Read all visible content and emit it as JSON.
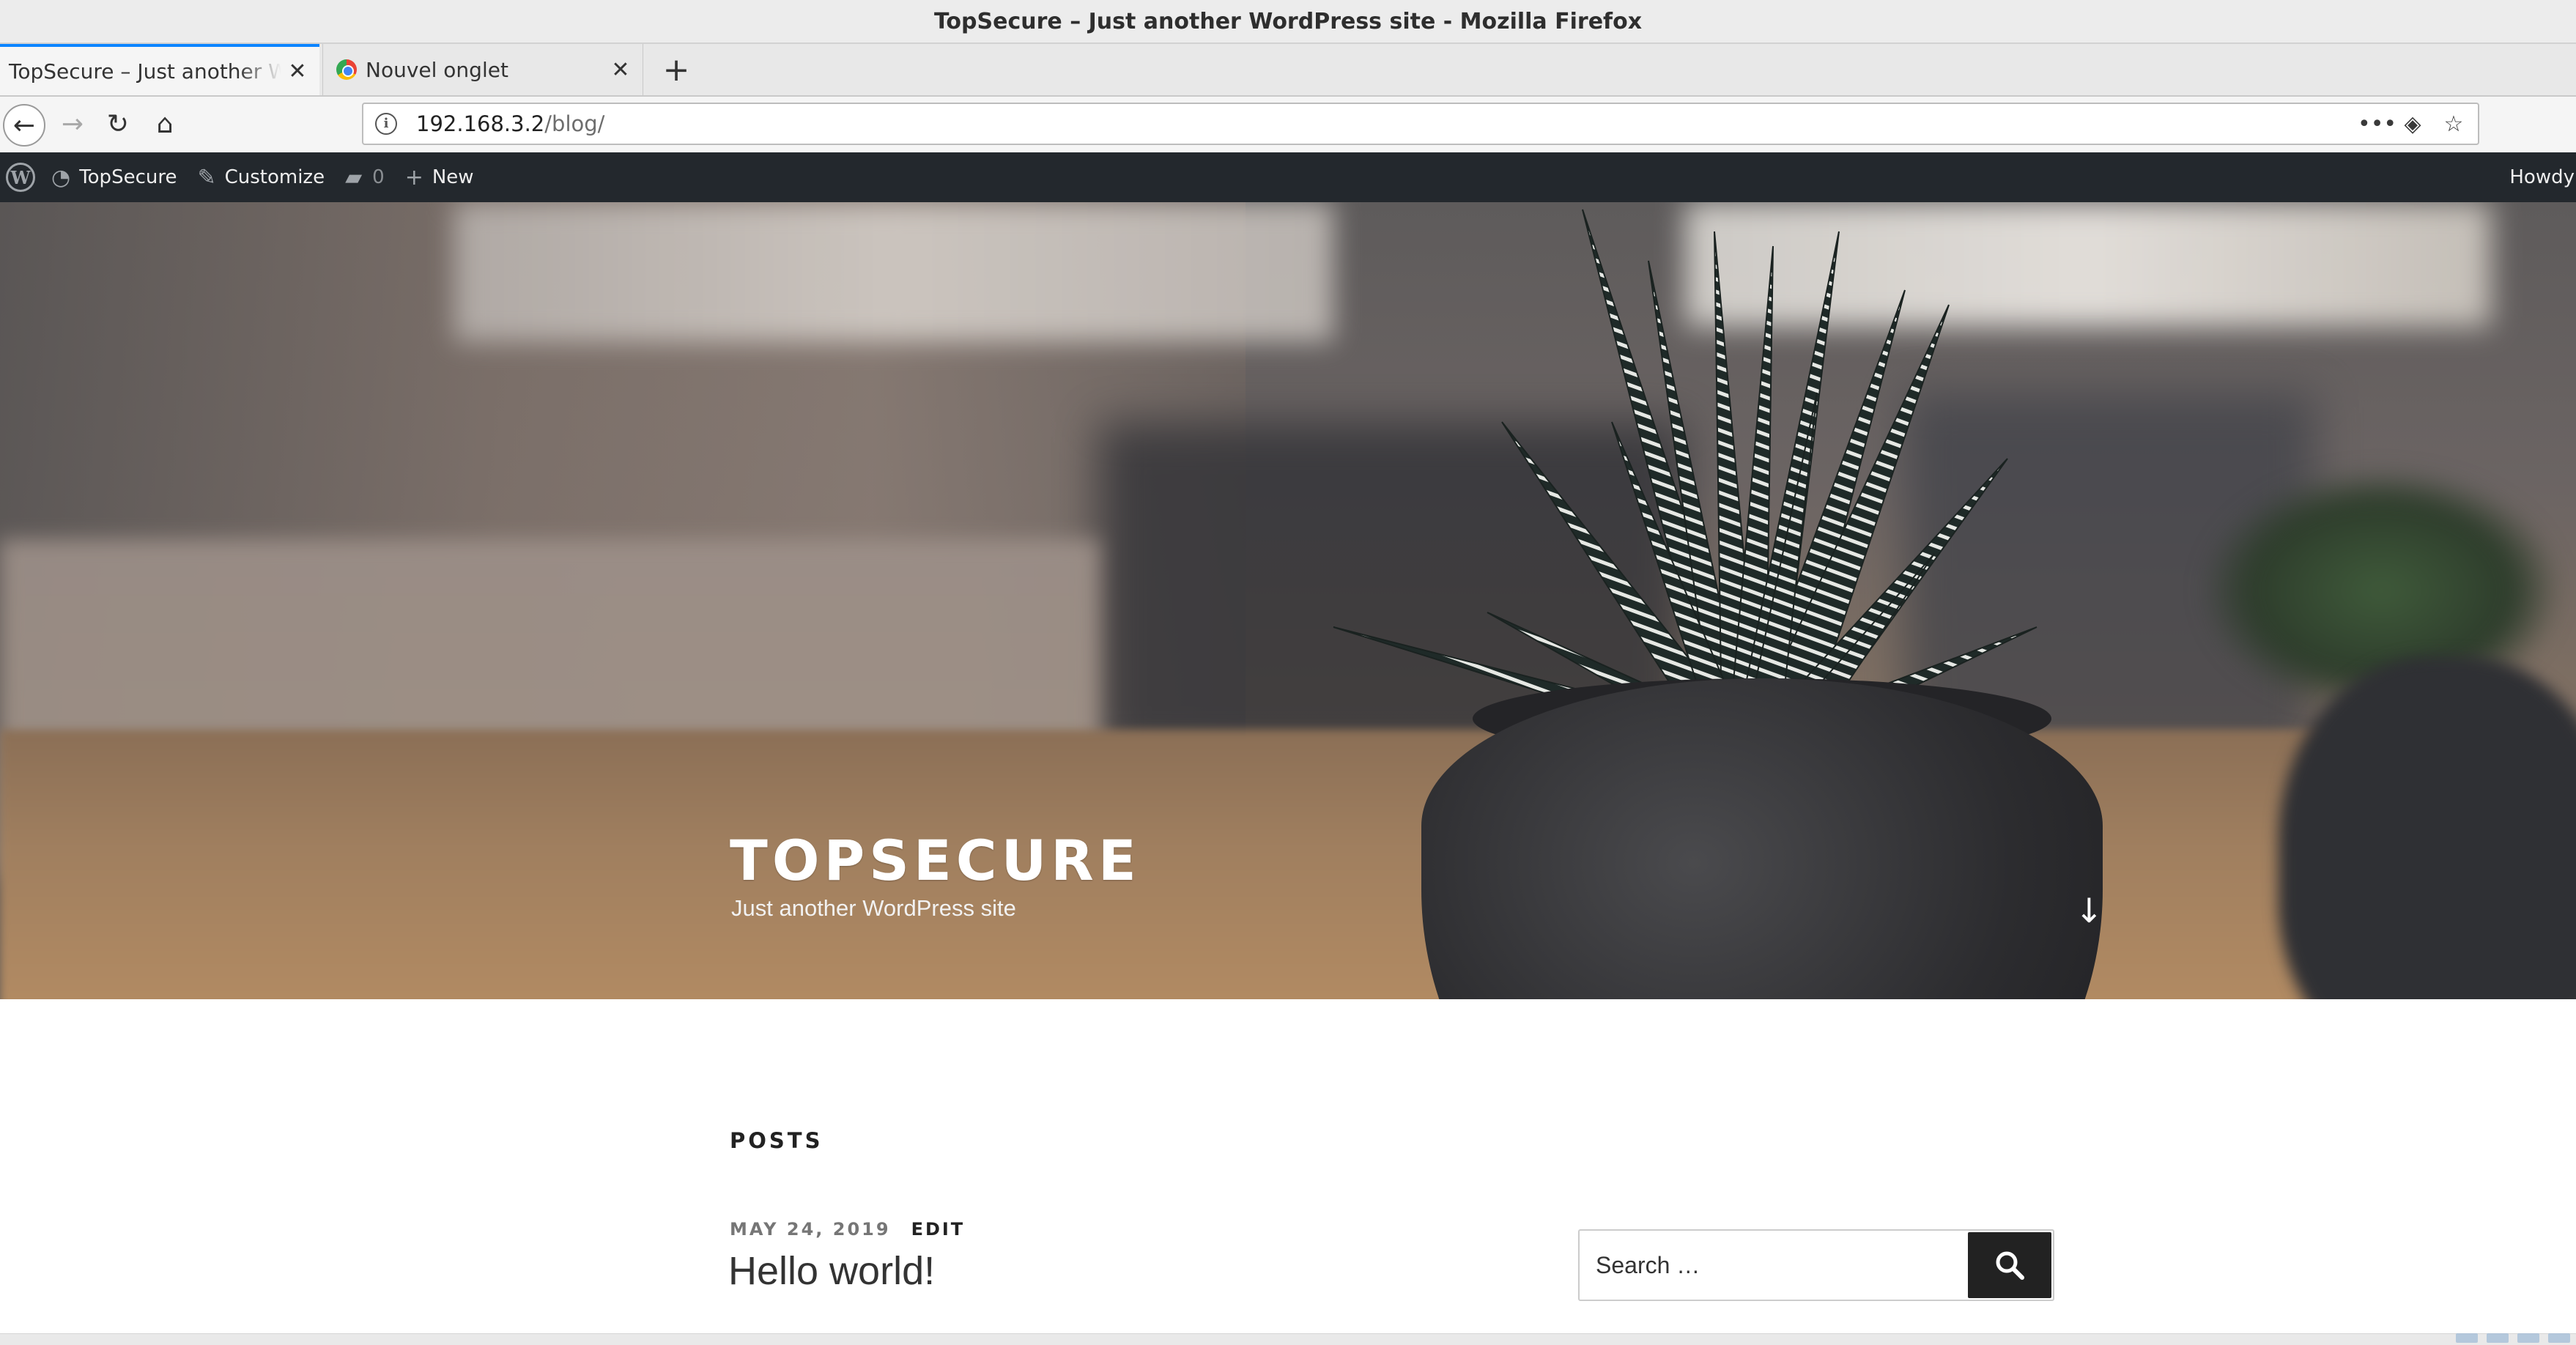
{
  "window": {
    "title": "TopSecure – Just another WordPress site - Mozilla Firefox"
  },
  "tabs": [
    {
      "title": "TopSecure – Just another WordPress site",
      "close": "✕"
    },
    {
      "title": "Nouvel onglet",
      "close": "✕"
    }
  ],
  "newtab_label": "+",
  "nav": {
    "back": "←",
    "forward": "→",
    "reload": "↻",
    "home": "⌂",
    "url_host": "192.168.3.2",
    "url_path": "/blog/",
    "page_actions": "•••",
    "pocket": "◈",
    "bookmark": "☆"
  },
  "adminbar": {
    "wp_logo": "W",
    "site_name": "TopSecure",
    "customize": "Customize",
    "comments_count": "0",
    "new_label": "New",
    "howdy": "Howdy"
  },
  "hero": {
    "site_title": "TOPSECURE",
    "site_description": "Just another WordPress site",
    "scroll_arrow": "↓"
  },
  "content": {
    "posts_heading": "POSTS",
    "post": {
      "date": "MAY 24, 2019",
      "edit": "EDIT",
      "title": "Hello world!"
    }
  },
  "search": {
    "placeholder": "Search …",
    "button_icon": "search-icon"
  }
}
